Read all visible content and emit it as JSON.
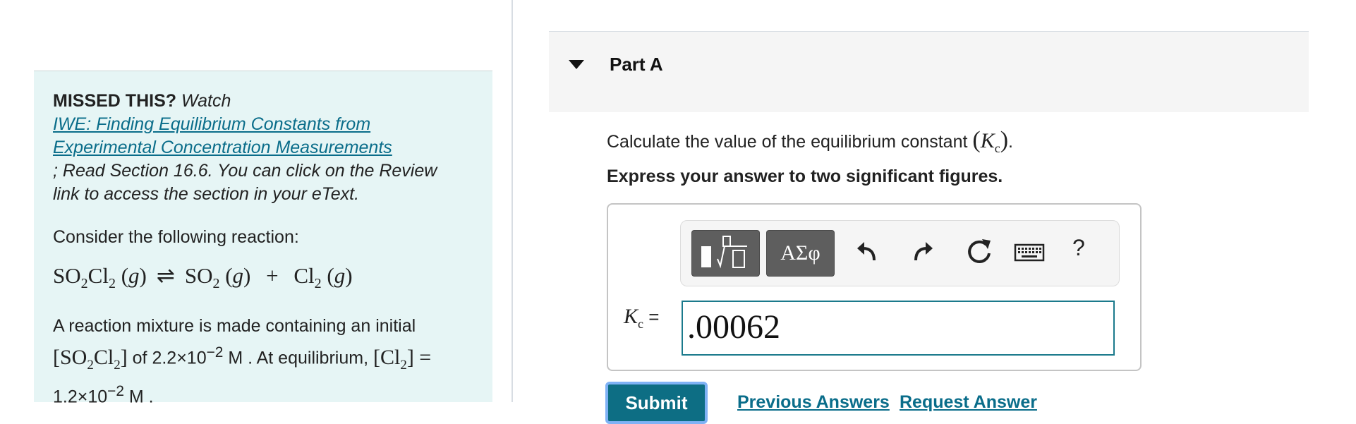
{
  "missed": {
    "title": "MISSED THIS?",
    "watch": "Watch",
    "link_line1": "IWE: Finding Equilibrium Constants from",
    "link_line2": "Experimental Concentration Measurements",
    "read_line1": "; Read Section 16.6. You can click on the Review",
    "read_line2": "link to access the section in your eText."
  },
  "problem": {
    "consider": "Consider the following reaction:",
    "mixture_text1": "A reaction mixture is made containing an initial",
    "mixture_text2": "of 2.2×10",
    "exp": "−2",
    "mixture_text3": "M . At equilibrium,",
    "mixture_text4": "1.2×10",
    "mixture_text5": "M ."
  },
  "part_a": {
    "title": "Part A",
    "question": "Calculate the value of the equilibrium constant",
    "instruction": "Express your answer to two significant figures.",
    "kc_label": "=",
    "input_value": ".00062",
    "greek_label": "ΑΣφ",
    "help_label": "?",
    "submit_label": "Submit",
    "previous_answers": "Previous Answers",
    "request_answer": "Request Answer"
  }
}
